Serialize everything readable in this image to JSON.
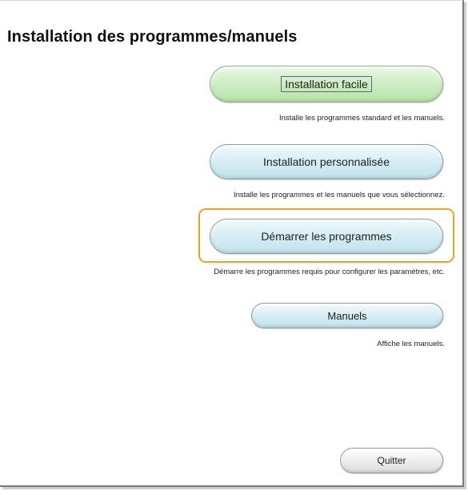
{
  "title": "Installation des programmes/manuels",
  "options": [
    {
      "label": "Installation facile",
      "description": "Installe les programmes standard et les manuels."
    },
    {
      "label": "Installation personnalisée",
      "description": "Installe les programmes et les manuels que vous sélectionnez."
    },
    {
      "label": "Démarrer les programmes",
      "description": "Démarre les programmes requis pour configurer les paramètres, etc."
    },
    {
      "label": "Manuels",
      "description": "Affiche les manuels."
    }
  ],
  "quit_label": "Quitter",
  "colors": {
    "easy_button": "#c9ecc0",
    "option_button": "#d3ecf3",
    "highlight": "#f0a020"
  }
}
